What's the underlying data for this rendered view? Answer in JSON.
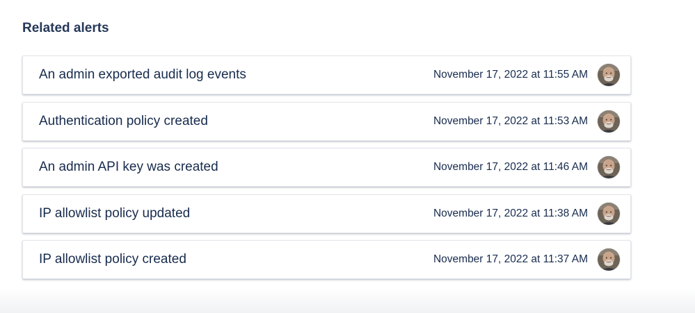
{
  "section": {
    "title": "Related alerts"
  },
  "alerts": [
    {
      "title": "An admin exported audit log events",
      "time": "November 17, 2022 at 11:55 AM"
    },
    {
      "title": "Authentication policy created",
      "time": "November 17, 2022 at 11:53 AM"
    },
    {
      "title": "An admin API key was created",
      "time": "November 17, 2022 at 11:46 AM"
    },
    {
      "title": "IP allowlist policy updated",
      "time": "November 17, 2022 at 11:38 AM"
    },
    {
      "title": "IP allowlist policy created",
      "time": "November 17, 2022 at 11:37 AM"
    }
  ],
  "colors": {
    "text": "#172b4d",
    "heading": "#253858",
    "card_border": "#e4e6ea"
  }
}
